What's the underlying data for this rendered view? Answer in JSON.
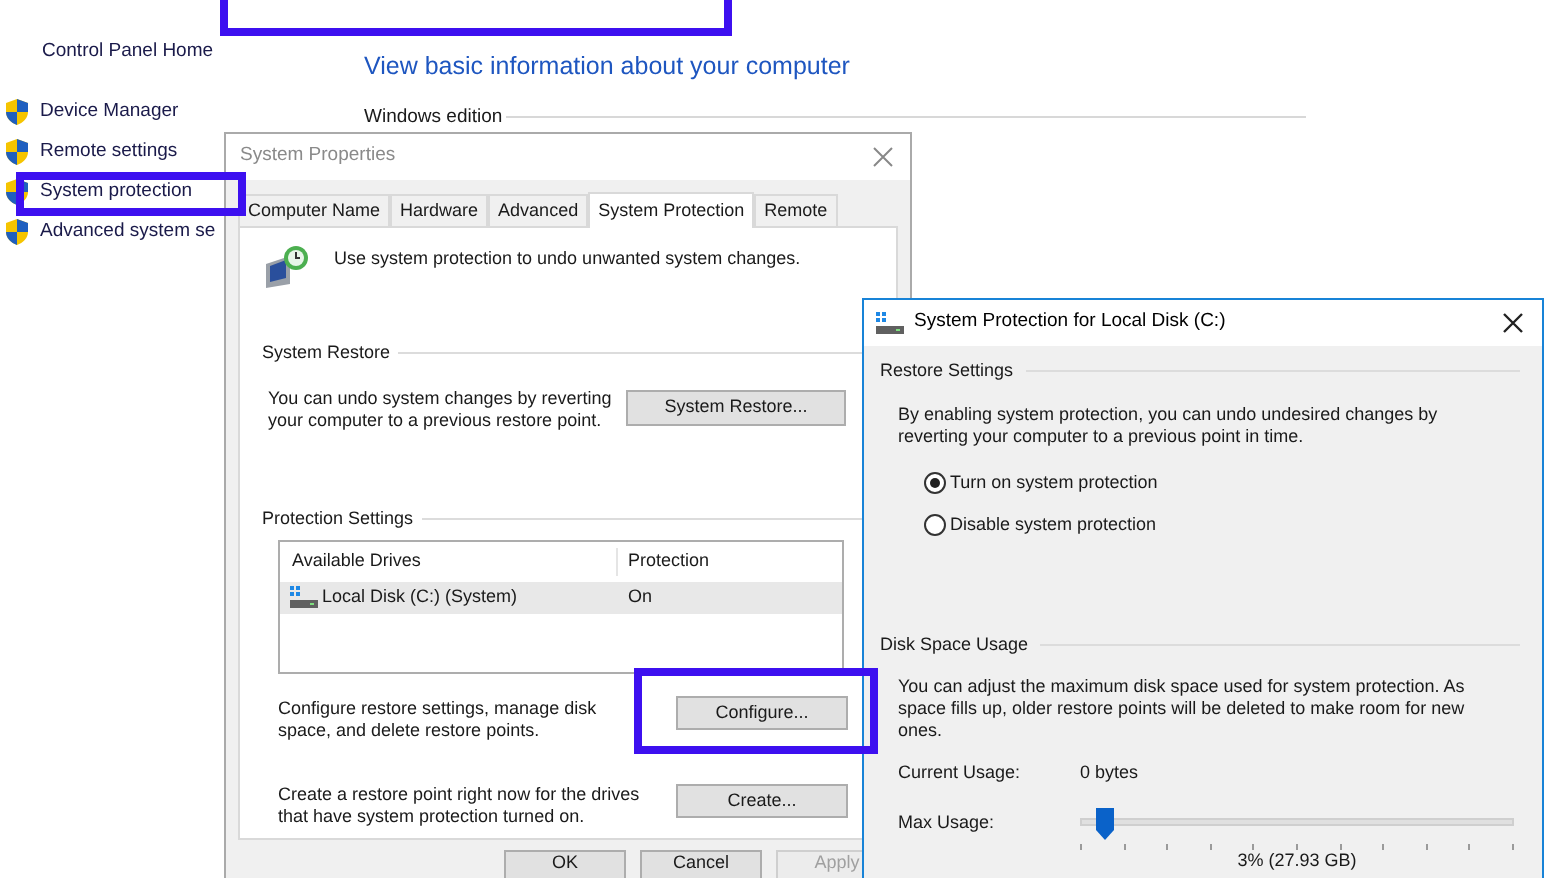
{
  "control_panel": {
    "sidebar": [
      {
        "label": "Control Panel Home",
        "kind": "link"
      },
      {
        "label": "Device Manager",
        "kind": "shield"
      },
      {
        "label": "Remote settings",
        "kind": "shield"
      },
      {
        "label": "System protection",
        "kind": "shield"
      },
      {
        "label": "Advanced system se",
        "kind": "shield"
      }
    ],
    "heading": "View basic information about your computer",
    "section": "Windows edition"
  },
  "system_properties": {
    "title": "System Properties",
    "tabs": [
      {
        "label": "Computer Name",
        "selected": false
      },
      {
        "label": "Hardware",
        "selected": false
      },
      {
        "label": "Advanced",
        "selected": false
      },
      {
        "label": "System Protection",
        "selected": true
      },
      {
        "label": "Remote",
        "selected": false
      }
    ],
    "intro": "Use system protection to undo unwanted system changes.",
    "restore_heading": "System Restore",
    "restore_text": "You can undo system changes by reverting your computer to a previous restore point.",
    "restore_button": "System Restore...",
    "protection_heading": "Protection Settings",
    "columns": [
      "Available Drives",
      "Protection"
    ],
    "rows": [
      {
        "drive": "Local Disk (C:) (System)",
        "protection": "On",
        "selected": true
      }
    ],
    "configure_text": "Configure restore settings, manage disk space, and delete restore points.",
    "configure_button": "Configure...",
    "create_text": "Create a restore point right now for the drives that have system protection turned on.",
    "create_button": "Create...",
    "buttons": [
      {
        "label": "OK",
        "disabled": false
      },
      {
        "label": "Cancel",
        "disabled": false
      },
      {
        "label": "Apply",
        "disabled": true
      }
    ]
  },
  "disk_dialog": {
    "title": "System Protection for Local Disk (C:)",
    "restore_heading": "Restore Settings",
    "restore_text": "By enabling system protection, you can undo undesired changes by reverting your computer to a previous point in time.",
    "options": [
      {
        "label": "Turn on system protection",
        "selected": true
      },
      {
        "label": "Disable system protection",
        "selected": false
      }
    ],
    "usage_heading": "Disk Space Usage",
    "usage_text": "You can adjust the maximum disk space used for system protection. As space fills up, older restore points will be deleted to make room for new ones.",
    "current_label": "Current Usage:",
    "current_value": "0 bytes",
    "max_label": "Max Usage:",
    "level": 0.04,
    "max_value": "3% (27.93 GB)"
  }
}
